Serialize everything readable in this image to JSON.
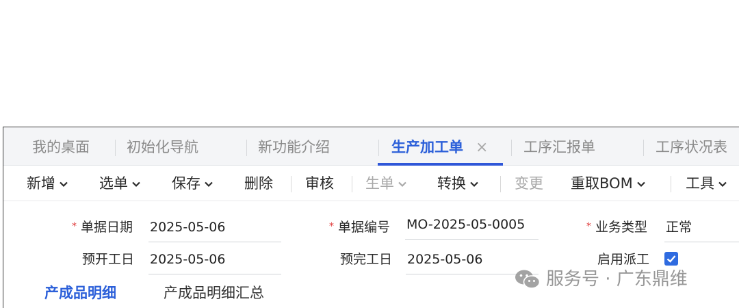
{
  "tabs": [
    {
      "label": "我的桌面"
    },
    {
      "label": "初始化导航"
    },
    {
      "label": "新功能介绍"
    },
    {
      "label": "生产加工单",
      "close": "×"
    },
    {
      "label": "工序汇报单"
    },
    {
      "label": "工序状况表"
    }
  ],
  "toolbar": {
    "new": "新增",
    "select": "选单",
    "save": "保存",
    "delete": "删除",
    "review": "审核",
    "generate": "生单",
    "convert": "转换",
    "change": "变更",
    "refetch_bom": "重取BOM",
    "tools": "工具"
  },
  "form": {
    "doc_date": {
      "label": "单据日期",
      "value": "2025-05-06"
    },
    "doc_no": {
      "label": "单据编号",
      "value": "MO-2025-05-0005"
    },
    "biz_type": {
      "label": "业务类型",
      "value": "正常"
    },
    "plan_start": {
      "label": "预开工日",
      "value": "2025-05-06"
    },
    "plan_finish": {
      "label": "预完工日",
      "value": "2025-05-06"
    },
    "enable_dispatch": {
      "label": "启用派工",
      "checked": true
    }
  },
  "subtabs": [
    {
      "label": "产成品明细"
    },
    {
      "label": "产成品明细汇总"
    }
  ],
  "watermark": {
    "text": "服务号 · 广东鼎维"
  },
  "colors": {
    "accent": "#2f57d8",
    "required": "#e03b3b",
    "checkbox": "#2f6be0"
  }
}
